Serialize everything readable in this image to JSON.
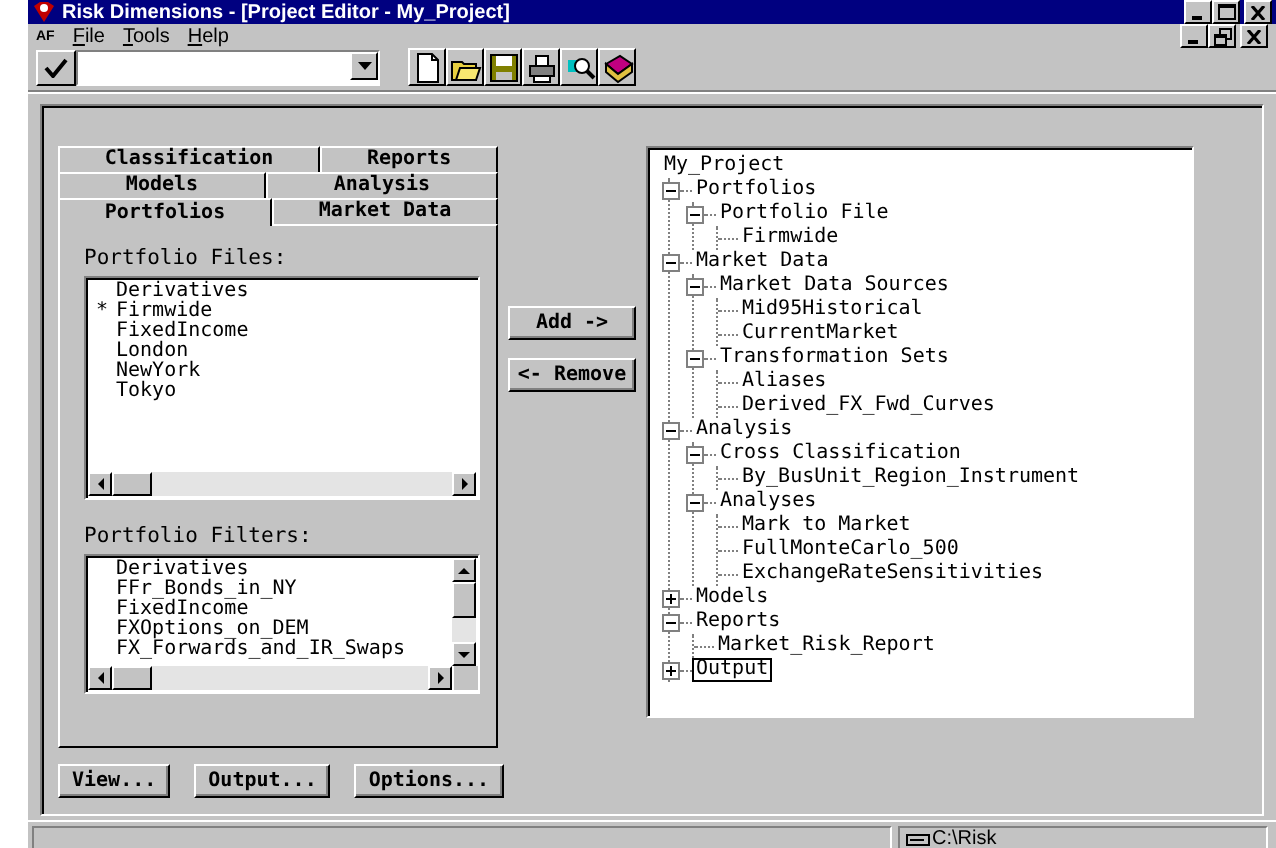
{
  "window": {
    "title": "Risk Dimensions - [Project Editor - My_Project]"
  },
  "menu": {
    "tag": "AF",
    "items": [
      {
        "label": "File"
      },
      {
        "label": "Tools"
      },
      {
        "label": "Help"
      }
    ]
  },
  "tab_rows": [
    [
      {
        "label": "Classification",
        "selected": false
      },
      {
        "label": "Reports",
        "selected": false
      }
    ],
    [
      {
        "label": "Models",
        "selected": false
      },
      {
        "label": "Analysis",
        "selected": false
      }
    ],
    [
      {
        "label": "Portfolios",
        "selected": true
      },
      {
        "label": "Market Data",
        "selected": false
      }
    ]
  ],
  "portfolio_files": {
    "label": "Portfolio Files:",
    "items": [
      {
        "text": "Derivatives"
      },
      {
        "text": "Firmwide",
        "marker": "*"
      },
      {
        "text": "FixedIncome"
      },
      {
        "text": "London"
      },
      {
        "text": "NewYork"
      },
      {
        "text": "Tokyo"
      }
    ]
  },
  "portfolio_filters": {
    "label": "Portfolio Filters:",
    "items": [
      {
        "text": "Derivatives"
      },
      {
        "text": "FFr_Bonds_in_NY"
      },
      {
        "text": "FixedIncome"
      },
      {
        "text": "FXOptions_on_DEM"
      },
      {
        "text": "FX_Forwards_and_IR_Swaps"
      }
    ]
  },
  "move_buttons": [
    "Add ->",
    "<- Remove"
  ],
  "bottom_buttons": [
    "View...",
    "Output...",
    "Options..."
  ],
  "tree": {
    "label": "My_Project",
    "children": [
      {
        "label": "Portfolios",
        "expanded": true,
        "selected": false,
        "children": [
          {
            "label": "Portfolio File",
            "expanded": true,
            "selected": false,
            "children": [
              {
                "label": "Firmwide",
                "selected": false
              }
            ]
          }
        ]
      },
      {
        "label": "Market Data",
        "expanded": true,
        "selected": false,
        "children": [
          {
            "label": "Market Data Sources",
            "expanded": true,
            "selected": false,
            "children": [
              {
                "label": "Mid95Historical",
                "selected": false
              },
              {
                "label": "CurrentMarket",
                "selected": false
              }
            ]
          },
          {
            "label": "Transformation Sets",
            "expanded": true,
            "selected": false,
            "children": [
              {
                "label": "Aliases",
                "selected": false
              },
              {
                "label": "Derived_FX_Fwd_Curves",
                "selected": false
              }
            ]
          }
        ]
      },
      {
        "label": "Analysis",
        "expanded": true,
        "selected": false,
        "children": [
          {
            "label": "Cross Classification",
            "expanded": true,
            "selected": false,
            "children": [
              {
                "label": "By_BusUnit_Region_Instrument",
                "selected": false
              }
            ]
          },
          {
            "label": "Analyses",
            "expanded": true,
            "selected": false,
            "children": [
              {
                "label": "Mark to Market",
                "selected": false
              },
              {
                "label": "FullMonteCarlo_500",
                "selected": false
              },
              {
                "label": "ExchangeRateSensitivities",
                "selected": false
              }
            ]
          }
        ]
      },
      {
        "label": "Models",
        "expanded": false,
        "selected": false
      },
      {
        "label": "Reports",
        "expanded": true,
        "selected": false,
        "children": [
          {
            "label": "Market_Risk_Report",
            "selected": false
          }
        ]
      },
      {
        "label": "Output",
        "expanded": false,
        "selected": true
      }
    ]
  },
  "status_bar": {
    "path": "C:\\Risk"
  }
}
